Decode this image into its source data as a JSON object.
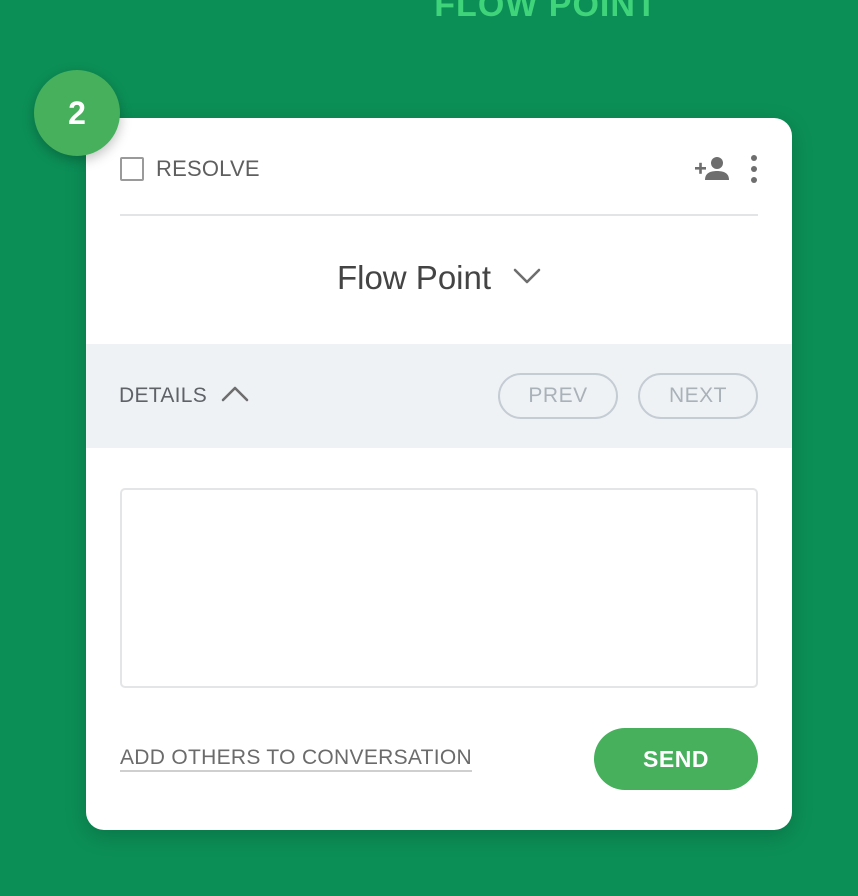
{
  "page": {
    "header_title": "FLOW POINT",
    "badge_number": "2"
  },
  "card": {
    "resolve_label": "RESOLVE",
    "point_title": "Flow Point",
    "details_label": "DETAILS",
    "prev_label": "PREV",
    "next_label": "NEXT",
    "message_placeholder": "",
    "add_others_label": "ADD OTHERS TO CONVERSATION",
    "send_label": "SEND"
  },
  "icons": {
    "add_user": "add-person-icon",
    "more": "more-vertical-icon",
    "title_dropdown": "chevron-down-icon",
    "details_toggle": "chevron-up-icon"
  },
  "colors": {
    "background": "#0c8f57",
    "accent_green": "#46b05c",
    "title_green": "#3fd37a",
    "details_bar": "#eff2f5"
  }
}
